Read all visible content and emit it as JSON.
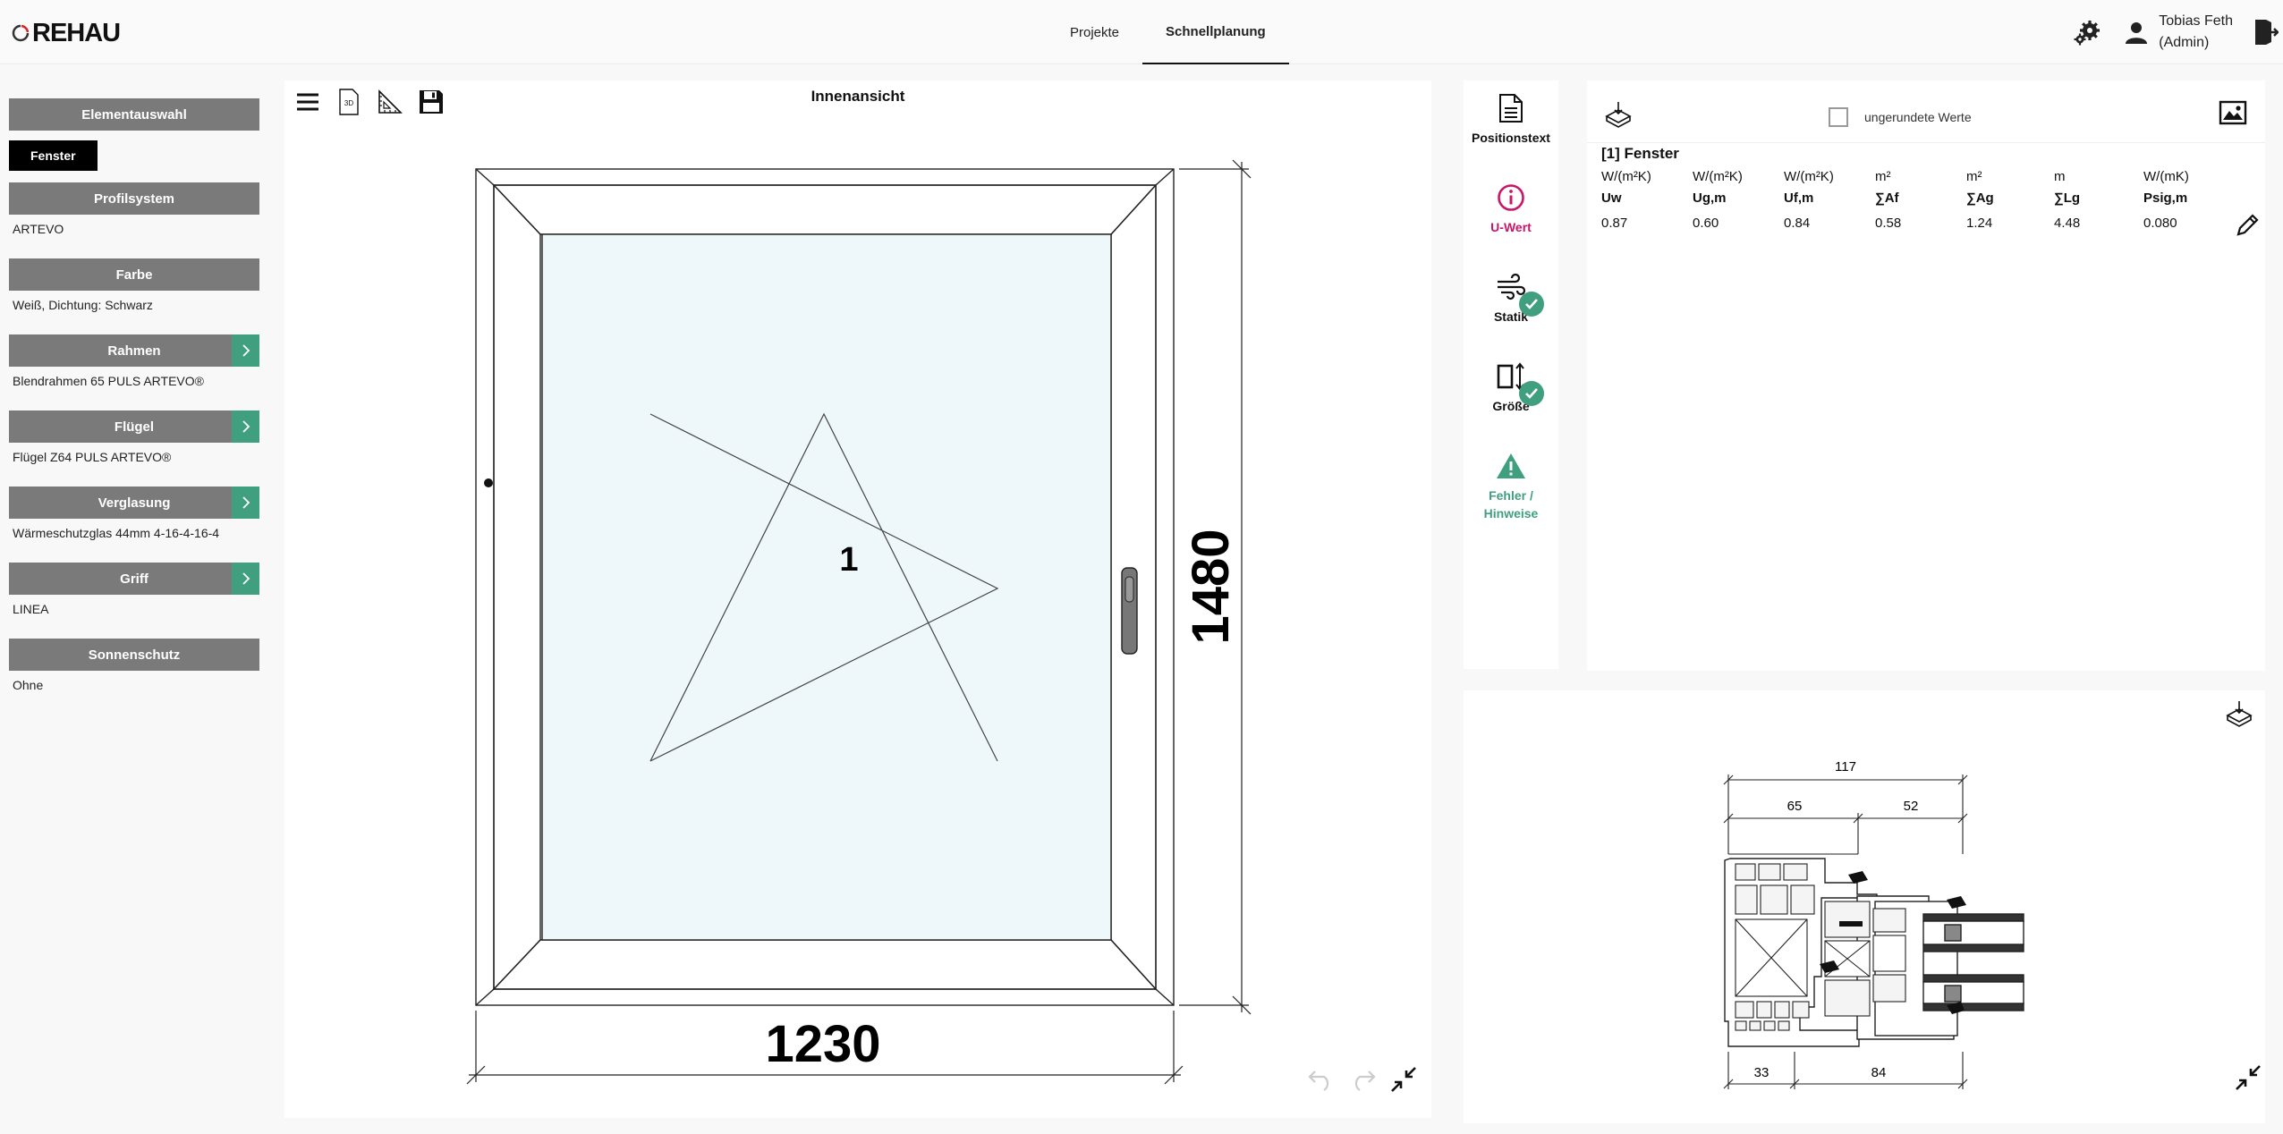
{
  "header": {
    "logo_text": "REHAU",
    "tabs": [
      {
        "label": "Projekte",
        "active": false
      },
      {
        "label": "Schnellplanung",
        "active": true
      }
    ],
    "user_name_line1": "Tobias Feth",
    "user_name_line2": "(Admin)"
  },
  "sidebar": {
    "element": {
      "heading": "Elementauswahl",
      "chip": "Fenster"
    },
    "sections": [
      {
        "heading": "Profilsystem",
        "value": "ARTEVO",
        "arrow": false
      },
      {
        "heading": "Farbe",
        "value": "Weiß, Dichtung: Schwarz",
        "arrow": false
      },
      {
        "heading": "Rahmen",
        "value": "Blendrahmen 65 PULS ARTEVO®",
        "arrow": true
      },
      {
        "heading": "Flügel",
        "value": "Flügel Z64 PULS ARTEVO®",
        "arrow": true
      },
      {
        "heading": "Verglasung",
        "value": "Wärmeschutzglas 44mm 4-16-4-16-4",
        "arrow": true
      },
      {
        "heading": "Griff",
        "value": "LINEA",
        "arrow": true
      },
      {
        "heading": "Sonnenschutz",
        "value": "Ohne",
        "arrow": false
      }
    ]
  },
  "canvas": {
    "view_title": "Innenansicht",
    "toolbar_3d_label": "3D",
    "width_dim": "1230",
    "height_dim": "1480",
    "sash_number": "1"
  },
  "rail": [
    {
      "label": "Positionstext",
      "icon": "document-icon",
      "check": false
    },
    {
      "label": "U-Wert",
      "icon": "info-circle-icon",
      "check": false
    },
    {
      "label": "Statik",
      "icon": "wind-icon",
      "check": true
    },
    {
      "label": "Größe",
      "icon": "resize-icon",
      "check": true
    },
    {
      "label_line1": "Fehler /",
      "label_line2": "Hinweise",
      "icon": "warning-icon",
      "check": false
    }
  ],
  "uwert": {
    "checkbox_label": "ungerundete Werte",
    "title": "[1] Fenster",
    "columns": [
      {
        "unit": "W/(m²K)",
        "name": "Uw",
        "value": "0.87"
      },
      {
        "unit": "W/(m²K)",
        "name": "Ug,m",
        "value": "0.60"
      },
      {
        "unit": "W/(m²K)",
        "name": "Uf,m",
        "value": "0.84"
      },
      {
        "unit": "m²",
        "name": "∑Af",
        "value": "0.58"
      },
      {
        "unit": "m²",
        "name": "∑Ag",
        "value": "1.24"
      },
      {
        "unit": "m",
        "name": "∑Lg",
        "value": "4.48"
      },
      {
        "unit": "W/(mK)",
        "name": "Psig,m",
        "value": "0.080"
      }
    ]
  },
  "profile": {
    "dim_total": "117",
    "dim_left": "65",
    "dim_right": "52",
    "dim_bottom_left": "33",
    "dim_bottom_right": "84"
  },
  "colors": {
    "accent_green": "#3f9f7f",
    "accent_magenta": "#c8176b",
    "sidebar_gray": "#7a7a7a",
    "glass": "#eef8fb"
  }
}
